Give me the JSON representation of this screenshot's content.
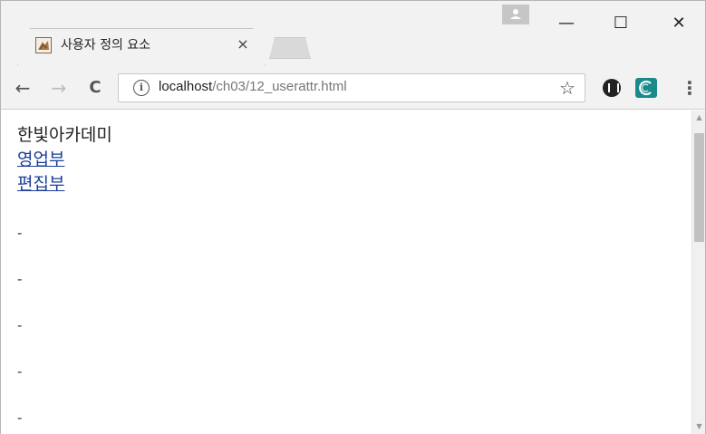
{
  "tab": {
    "title": "사용자 정의 요소",
    "close_glyph": "×",
    "favicon_icon": "page-favicon-icon"
  },
  "window_controls": {
    "minimize_glyph": "—",
    "maximize_glyph": "☐",
    "close_glyph": "✕"
  },
  "toolbar": {
    "back_glyph": "←",
    "forward_glyph": "→",
    "reload_glyph": "C",
    "info_glyph": "i",
    "url_host": "localhost",
    "url_path": "/ch03/12_userattr.html",
    "star_glyph": "☆",
    "menu_glyph": "⋮"
  },
  "page": {
    "heading": "한빛아카데미",
    "links": [
      {
        "label": "영업부"
      },
      {
        "label": "편집부"
      }
    ],
    "dashes": [
      "-",
      "-",
      "-",
      "-",
      "-"
    ]
  },
  "colors": {
    "link": "#1a3e9a",
    "chrome_bg": "#f2f2f2",
    "ext_teal": "#1d8a8a"
  }
}
